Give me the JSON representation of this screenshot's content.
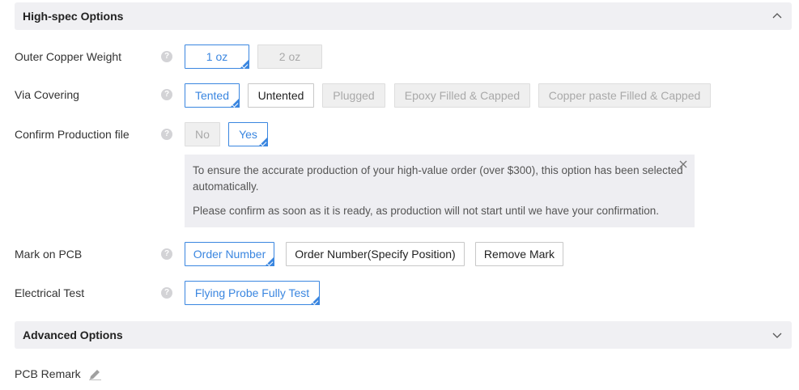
{
  "highspec": {
    "title": "High-spec Options",
    "rows": {
      "outer_copper": {
        "label": "Outer Copper Weight",
        "options": [
          "1 oz",
          "2 oz"
        ]
      },
      "via_covering": {
        "label": "Via Covering",
        "options": [
          "Tented",
          "Untented",
          "Plugged",
          "Epoxy Filled & Capped",
          "Copper paste Filled & Capped"
        ]
      },
      "confirm_file": {
        "label": "Confirm Production file",
        "options": [
          "No",
          "Yes"
        ],
        "notice_line1": "To ensure the accurate production of your high-value order (over $300), this option has been selected automatically.",
        "notice_line2": "Please confirm as soon as it is ready, as production will not start until we have your confirmation."
      },
      "mark_on_pcb": {
        "label": "Mark on PCB",
        "options": [
          "Order Number",
          "Order Number(Specify Position)",
          "Remove Mark"
        ]
      },
      "electrical_test": {
        "label": "Electrical Test",
        "options": [
          "Flying Probe Fully Test"
        ]
      }
    },
    "help_glyph": "?"
  },
  "advanced": {
    "title": "Advanced Options",
    "remark_label": "PCB Remark"
  },
  "icons": {
    "collapse": "chevron-up-icon",
    "expand": "chevron-down-icon",
    "help": "question-circle-icon",
    "close": "close-icon",
    "edit": "pencil-icon"
  },
  "colors": {
    "accent": "#3a86e0",
    "header_bg": "#f0f0f3",
    "disabled_bg": "#efefef",
    "notice_bg": "#eeeef2"
  }
}
